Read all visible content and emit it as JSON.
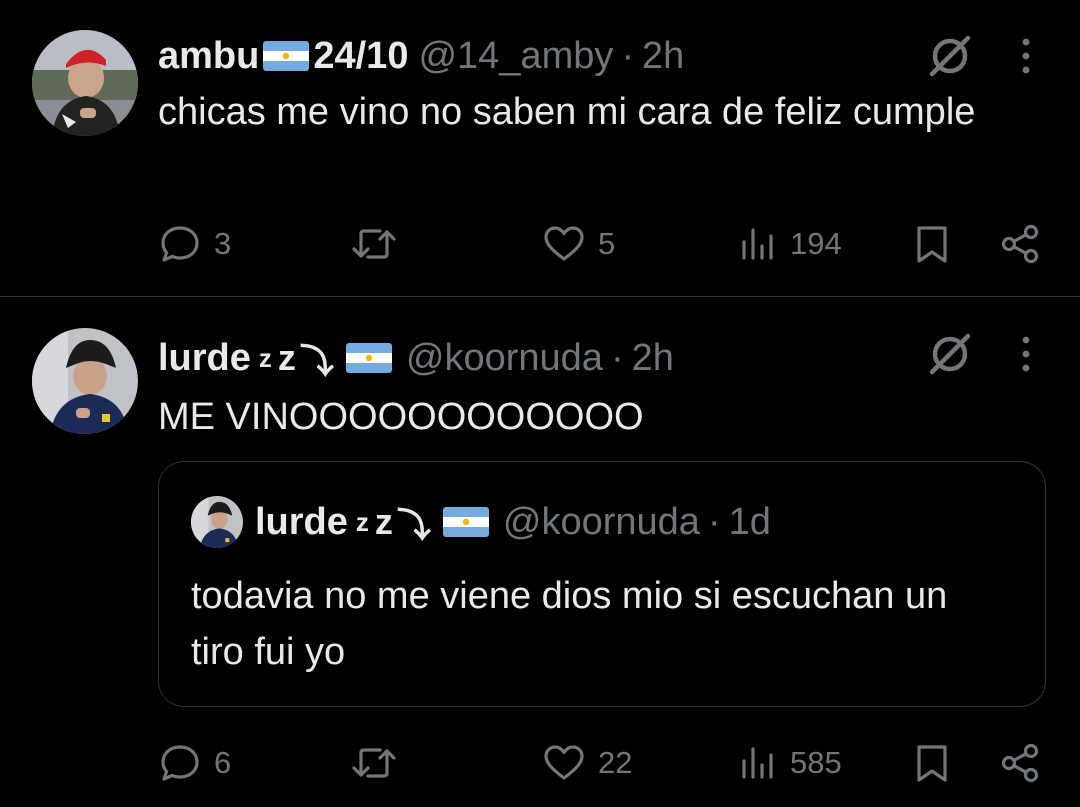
{
  "tweets": [
    {
      "author": {
        "name": "ambu",
        "name_suffix": "24/10",
        "handle": "@14_amby",
        "time": "2h",
        "avatar": "avatar-photo"
      },
      "text": "chicas me vino no saben mi cara de feliz cumple",
      "stats": {
        "replies": "3",
        "retweets": "",
        "likes": "5",
        "views": "194"
      }
    },
    {
      "author": {
        "name": "lurde",
        "name_zz_small": "z",
        "name_zz_big": "z",
        "name_arrow": "⤵",
        "handle": "@koornuda",
        "time": "2h",
        "avatar": "avatar-photo"
      },
      "text": "ME VINOOOOOOOOOOOO",
      "quote": {
        "author": {
          "name": "lurde",
          "name_zz_small": "z",
          "name_zz_big": "z",
          "name_arrow": "⤵",
          "handle": "@koornuda",
          "time": "1d"
        },
        "text": "todavia no me viene dios mio si escuchan un tiro fui yo"
      },
      "stats": {
        "replies": "6",
        "retweets": "",
        "likes": "22",
        "views": "585"
      }
    }
  ],
  "separator": "·",
  "icons": {
    "grok": "grok-icon",
    "more": "more-icon",
    "reply": "reply-icon",
    "retweet": "retweet-icon",
    "like": "heart-icon",
    "views": "views-icon",
    "bookmark": "bookmark-icon",
    "share": "share-icon",
    "flag": "argentina-flag-icon"
  },
  "colors": {
    "background": "#000000",
    "text": "#e7e9ea",
    "muted": "#71767b",
    "divider": "#2f3336",
    "flag_blue": "#74acdf",
    "flag_sun": "#f6b40e"
  }
}
